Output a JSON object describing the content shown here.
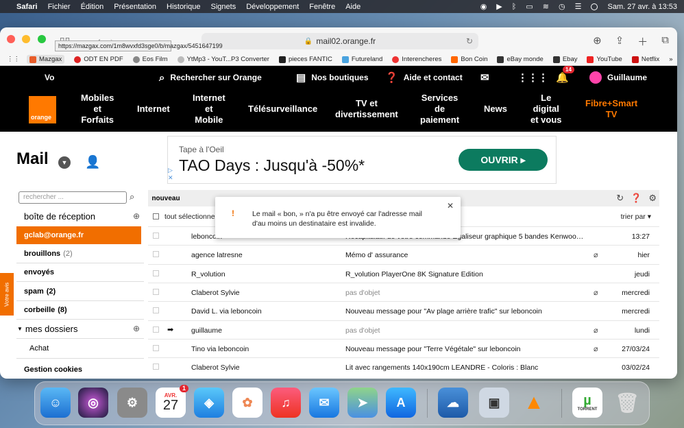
{
  "menubar": {
    "app": "Safari",
    "menus": [
      "Fichier",
      "Édition",
      "Présentation",
      "Historique",
      "Signets",
      "Développement",
      "Fenêtre",
      "Aide"
    ],
    "datetime": "Sam. 27 avr. à 13:53"
  },
  "browser": {
    "url": "mail02.orange.fr",
    "favorites": [
      "Mazgax",
      "ODT EN PDF",
      "Eos Film",
      "YtMp3 - YouT...P3 Converter",
      "pieces FANTIC",
      "Futureland",
      "Interencheres",
      "Bon Coin",
      "eBay monde",
      "Ebay",
      "YouTube",
      "Netflix"
    ],
    "tooltip": "https://mazgax.com/1m8wvxfd3sge0/b/mazgax/5451647199"
  },
  "topnav": {
    "search": "Rechercher sur Orange",
    "shops": "Nos boutiques",
    "help": "Aide et contact",
    "notif_count": "14",
    "user": "Guillaume",
    "partial": "Vo"
  },
  "mainnav": {
    "logo": "orange",
    "items": [
      "Mobiles\net\nForfaits",
      "Internet",
      "Internet\net\nMobile",
      "Télésurveillance",
      "TV et\ndivertissement",
      "Services\nde\npaiement",
      "News",
      "Le\ndigital\net vous",
      "Fibre+Smart\nTV"
    ]
  },
  "mail": {
    "title": "Mail",
    "search_placeholder": "rechercher ...",
    "ad": {
      "line1": "Tape à l'Oeil",
      "line2": "TAO Days : Jusqu'à -50%*",
      "button": "OUVRIR"
    },
    "folders": {
      "inbox": "boîte de réception",
      "account": "gclab@orange.fr",
      "drafts": "brouillons",
      "drafts_count": "(2)",
      "sent": "envoyés",
      "spam": "spam",
      "spam_count": "(2)",
      "trash": "corbeille",
      "trash_count": "(8)",
      "my_folders": "mes dossiers",
      "achat": "Achat",
      "cookies": "Gestion cookies"
    },
    "list": {
      "new": "nouveau",
      "select_all": "tout sélectionner",
      "sort": "trier par",
      "rows": [
        {
          "from": "leboncoin",
          "subject": "Récapitulatif de votre commande Égaliseur graphique 5 bandes Kenwood…",
          "date": "13:27",
          "clip": false,
          "arrow": false,
          "grey": false
        },
        {
          "from": "agence latresne",
          "subject": "Mémo d' assurance",
          "date": "hier",
          "clip": true,
          "arrow": false,
          "grey": false
        },
        {
          "from": "R_volution",
          "subject": "R_volution PlayerOne 8K Signature Edition",
          "date": "jeudi",
          "clip": false,
          "arrow": false,
          "grey": false
        },
        {
          "from": "Claberot Sylvie",
          "subject": "pas d'objet",
          "date": "mercredi",
          "clip": true,
          "arrow": false,
          "grey": true
        },
        {
          "from": "David L. via leboncoin",
          "subject": "Nouveau message pour \"Av plage arrière trafic\" sur leboncoin",
          "date": "mercredi",
          "clip": false,
          "arrow": false,
          "grey": false
        },
        {
          "from": "guillaume",
          "subject": "pas d'objet",
          "date": "lundi",
          "clip": true,
          "arrow": true,
          "grey": true
        },
        {
          "from": "Tino via leboncoin",
          "subject": "Nouveau message pour \"Terre Végétale\" sur leboncoin",
          "date": "27/03/24",
          "clip": true,
          "arrow": false,
          "grey": false
        },
        {
          "from": "Claberot Sylvie",
          "subject": "Lit avec rangements 140x190cm LEANDRE - Coloris : Blanc",
          "date": "03/02/24",
          "clip": false,
          "arrow": false,
          "grey": false
        }
      ]
    },
    "popup": "Le mail « bon, » n'a pu être envoyé car l'adresse mail d'au moins un destinataire est invalide.",
    "feedback": "Votre avis"
  },
  "dock": {
    "calendar_month": "AVR.",
    "calendar_day": "27",
    "calendar_badge": "1",
    "torrent_label": "TORRENT"
  }
}
